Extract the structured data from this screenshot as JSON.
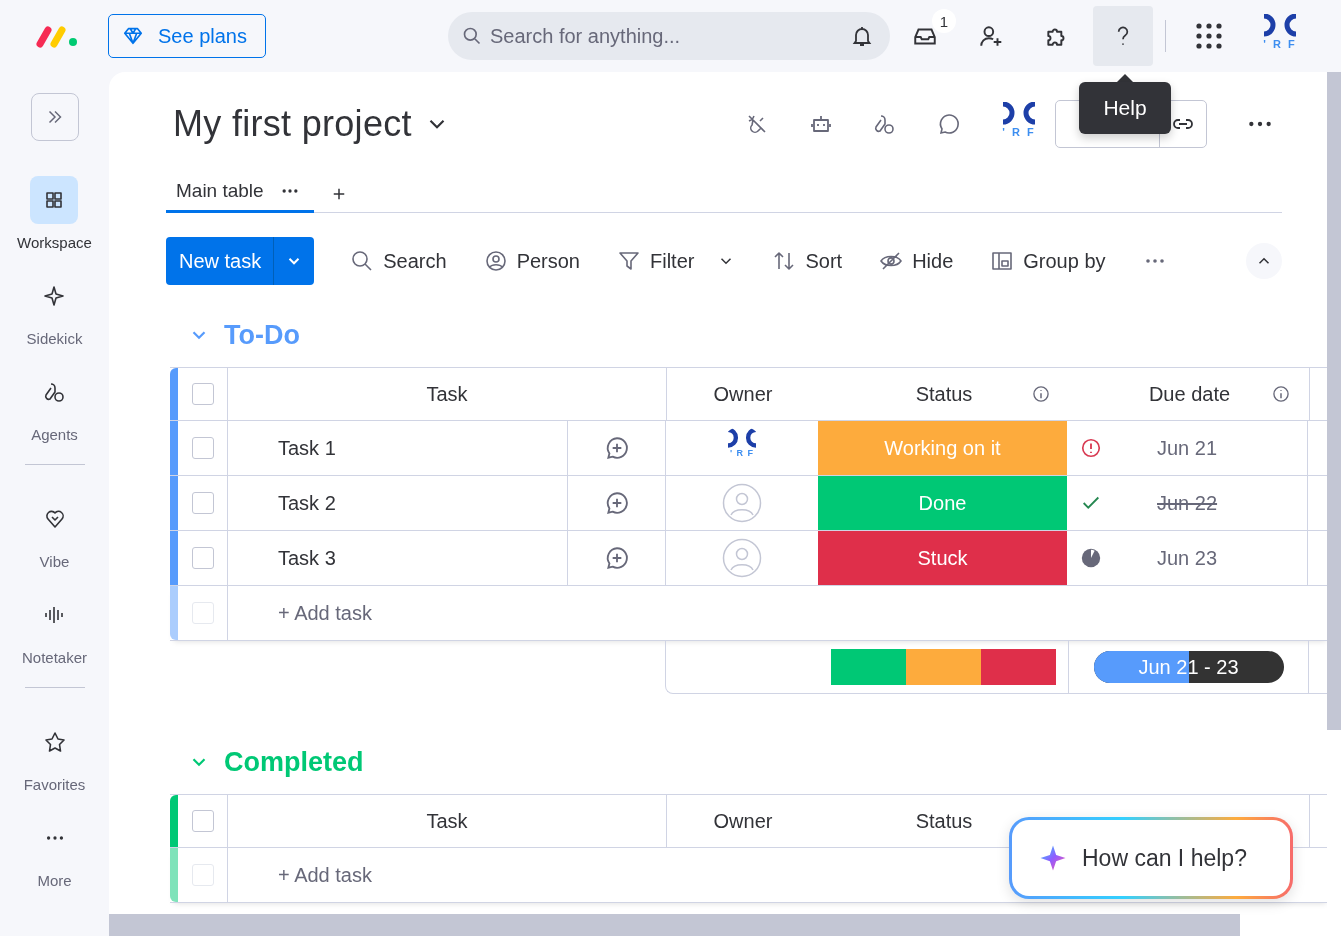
{
  "topbar": {
    "see_plans": "See plans",
    "search": {
      "placeholder": "Search for anything..."
    },
    "inbox_badge": "1",
    "help_selected": true,
    "tooltip": "Help",
    "avatar_text": "' R F"
  },
  "sidebar": {
    "items": [
      {
        "label": "Workspace",
        "selected": true,
        "divider_after": false
      },
      {
        "label": "Sidekick",
        "selected": false,
        "divider_after": false
      },
      {
        "label": "Agents",
        "selected": false,
        "divider_after": true
      },
      {
        "label": "Vibe",
        "selected": false,
        "divider_after": false
      },
      {
        "label": "Notetaker",
        "selected": false,
        "divider_after": true
      },
      {
        "label": "Favorites",
        "selected": false,
        "divider_after": false
      },
      {
        "label": "More",
        "selected": false,
        "divider_after": false
      }
    ]
  },
  "board": {
    "title": "My first project",
    "avatar_text": "' R F",
    "tabs": [
      {
        "label": "Main table",
        "selected": true
      }
    ],
    "new_task": "New task",
    "tools": [
      {
        "label": "Search"
      },
      {
        "label": "Person"
      },
      {
        "label": "Filter"
      },
      {
        "label": "Sort"
      },
      {
        "label": "Hide"
      },
      {
        "label": "Group by"
      }
    ]
  },
  "groups": [
    {
      "title": "To-Do",
      "color": "#579bfc",
      "header_checked": false,
      "columns": [
        "Task",
        "Owner",
        "Status",
        "Due date"
      ],
      "rows": [
        {
          "task": "Task 1",
          "checked": false,
          "owner_assigned": true,
          "owner_text": "' R F",
          "status": "Working on it",
          "color": "#fdab3d",
          "due": "Jun 21",
          "overdue": true,
          "done": false
        },
        {
          "task": "Task 2",
          "checked": false,
          "owner_assigned": false,
          "status": "Done",
          "color": "#00c875",
          "due": "Jun 22",
          "overdue": false,
          "done": true
        },
        {
          "task": "Task 3",
          "checked": false,
          "owner_assigned": false,
          "status": "Stuck",
          "color": "#df2f4a",
          "due": "Jun 23",
          "overdue": false,
          "done": false
        }
      ],
      "add_task": "+ Add task",
      "add_checked": false,
      "summary": {
        "status_segments": [
          {
            "color": "#00c875"
          },
          {
            "color": "#fdab3d"
          },
          {
            "color": "#df2f4a"
          }
        ],
        "date_range": "Jun 21 - 23",
        "level": 0.5
      }
    },
    {
      "title": "Completed",
      "color": "#00c875",
      "header_checked": false,
      "columns": [
        "Task",
        "Owner",
        "Status"
      ],
      "add_task": "+ Add task",
      "add_checked": false
    }
  ],
  "assistant": {
    "prompt": "How can I help?"
  }
}
